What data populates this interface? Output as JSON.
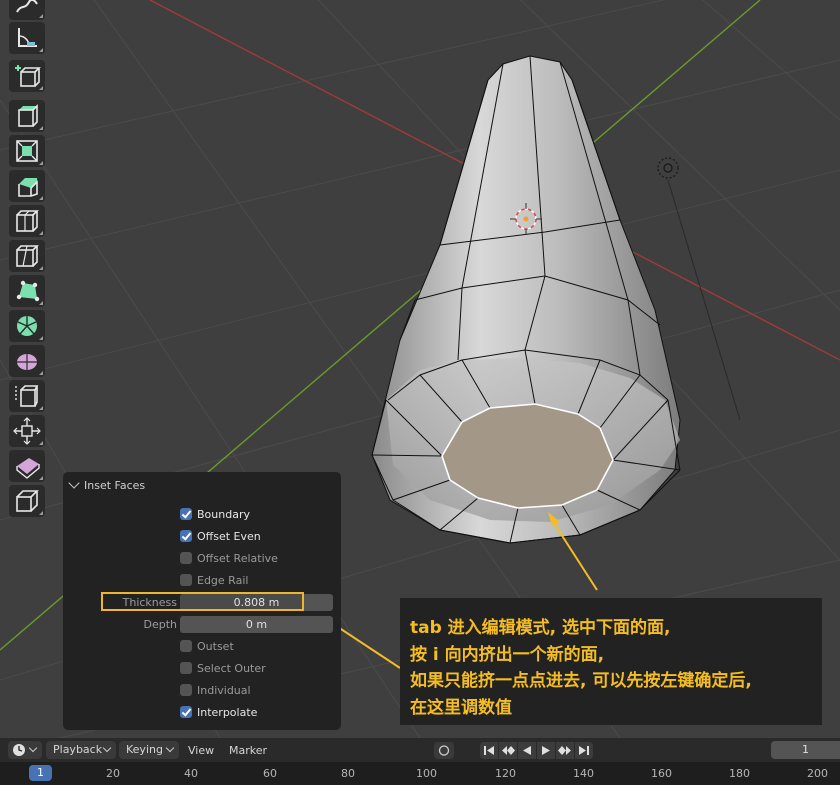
{
  "operator_panel": {
    "title": "Inset Faces",
    "options": [
      {
        "label": "Boundary",
        "checked": true
      },
      {
        "label": "Offset Even",
        "checked": true
      },
      {
        "label": "Offset Relative",
        "checked": false
      },
      {
        "label": "Edge Rail",
        "checked": false
      }
    ],
    "thickness_label": "Thickness",
    "thickness_value": "0.808 m",
    "depth_label": "Depth",
    "depth_value": "0 m",
    "options2": [
      {
        "label": "Outset",
        "checked": false
      },
      {
        "label": "Select Outer",
        "checked": false
      },
      {
        "label": "Individual",
        "checked": false
      },
      {
        "label": "Interpolate",
        "checked": true
      }
    ]
  },
  "annotation": {
    "lines": [
      "tab 进入编辑模式, 选中下面的面,",
      "按 i 向内挤出一个新的面,",
      "如果只能挤一点点进去, 可以先按左键确定后,",
      "在这里调数值"
    ]
  },
  "toolbar": {
    "tools": [
      "annotate-line-tool-icon",
      "measure-tool-icon",
      "add-cube-tool-icon",
      "extrude-region-tool-icon",
      "inset-faces-tool-icon",
      "bevel-tool-icon",
      "loop-cut-tool-icon",
      "knife-tool-icon",
      "poly-build-tool-icon",
      "spin-tool-icon",
      "smooth-tool-icon",
      "edge-slide-tool-icon",
      "shrink-fatten-tool-icon",
      "shear-tool-icon",
      "rip-region-tool-icon"
    ]
  },
  "timeline": {
    "playback_label": "Playback",
    "keying_label": "Keying",
    "view_label": "View",
    "marker_label": "Marker",
    "current_frame": "1",
    "ruler_current": "1",
    "ticks": [
      "20",
      "40",
      "60",
      "80",
      "100",
      "120",
      "140",
      "160",
      "180",
      "200"
    ]
  },
  "colors": {
    "accent": "#4772b3",
    "annotation_text": "#f5bd24",
    "highlight_box": "#f0b52a",
    "x_axis": "#a03a3a",
    "y_axis": "#6a9a2a",
    "selected_face": "#a39888"
  }
}
